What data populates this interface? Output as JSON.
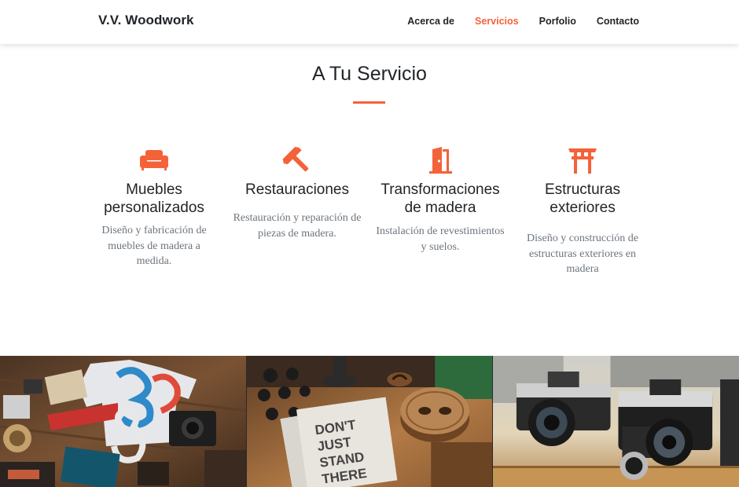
{
  "navbar": {
    "brand": "V.V. Woodwork",
    "links": [
      {
        "label": "Acerca de",
        "active": false
      },
      {
        "label": "Servicios",
        "active": true
      },
      {
        "label": "Porfolio",
        "active": false
      },
      {
        "label": "Contacto",
        "active": false
      }
    ]
  },
  "services": {
    "title": "A Tu Servicio",
    "items": [
      {
        "icon": "couch-icon",
        "title_line1": "Muebles",
        "title_line2": "personalizados",
        "description": "Diseño y fabricación de muebles de madera a medida."
      },
      {
        "icon": "hammer-icon",
        "title_line1": "Restauraciones",
        "title_line2": "",
        "description": "Restauración y reparación de piezas de madera."
      },
      {
        "icon": "door-open-icon",
        "title_line1": "Transformaciones",
        "title_line2": "de madera",
        "description": "Instalación de revestimientos y suelos."
      },
      {
        "icon": "torii-gate-icon",
        "title_line1": "Estructuras",
        "title_line2": "exteriores",
        "description": "Diseño y construcción de estructuras exteriores en madera"
      }
    ]
  },
  "colors": {
    "accent": "#f4623a",
    "text": "#212529",
    "muted": "#6c757d"
  }
}
